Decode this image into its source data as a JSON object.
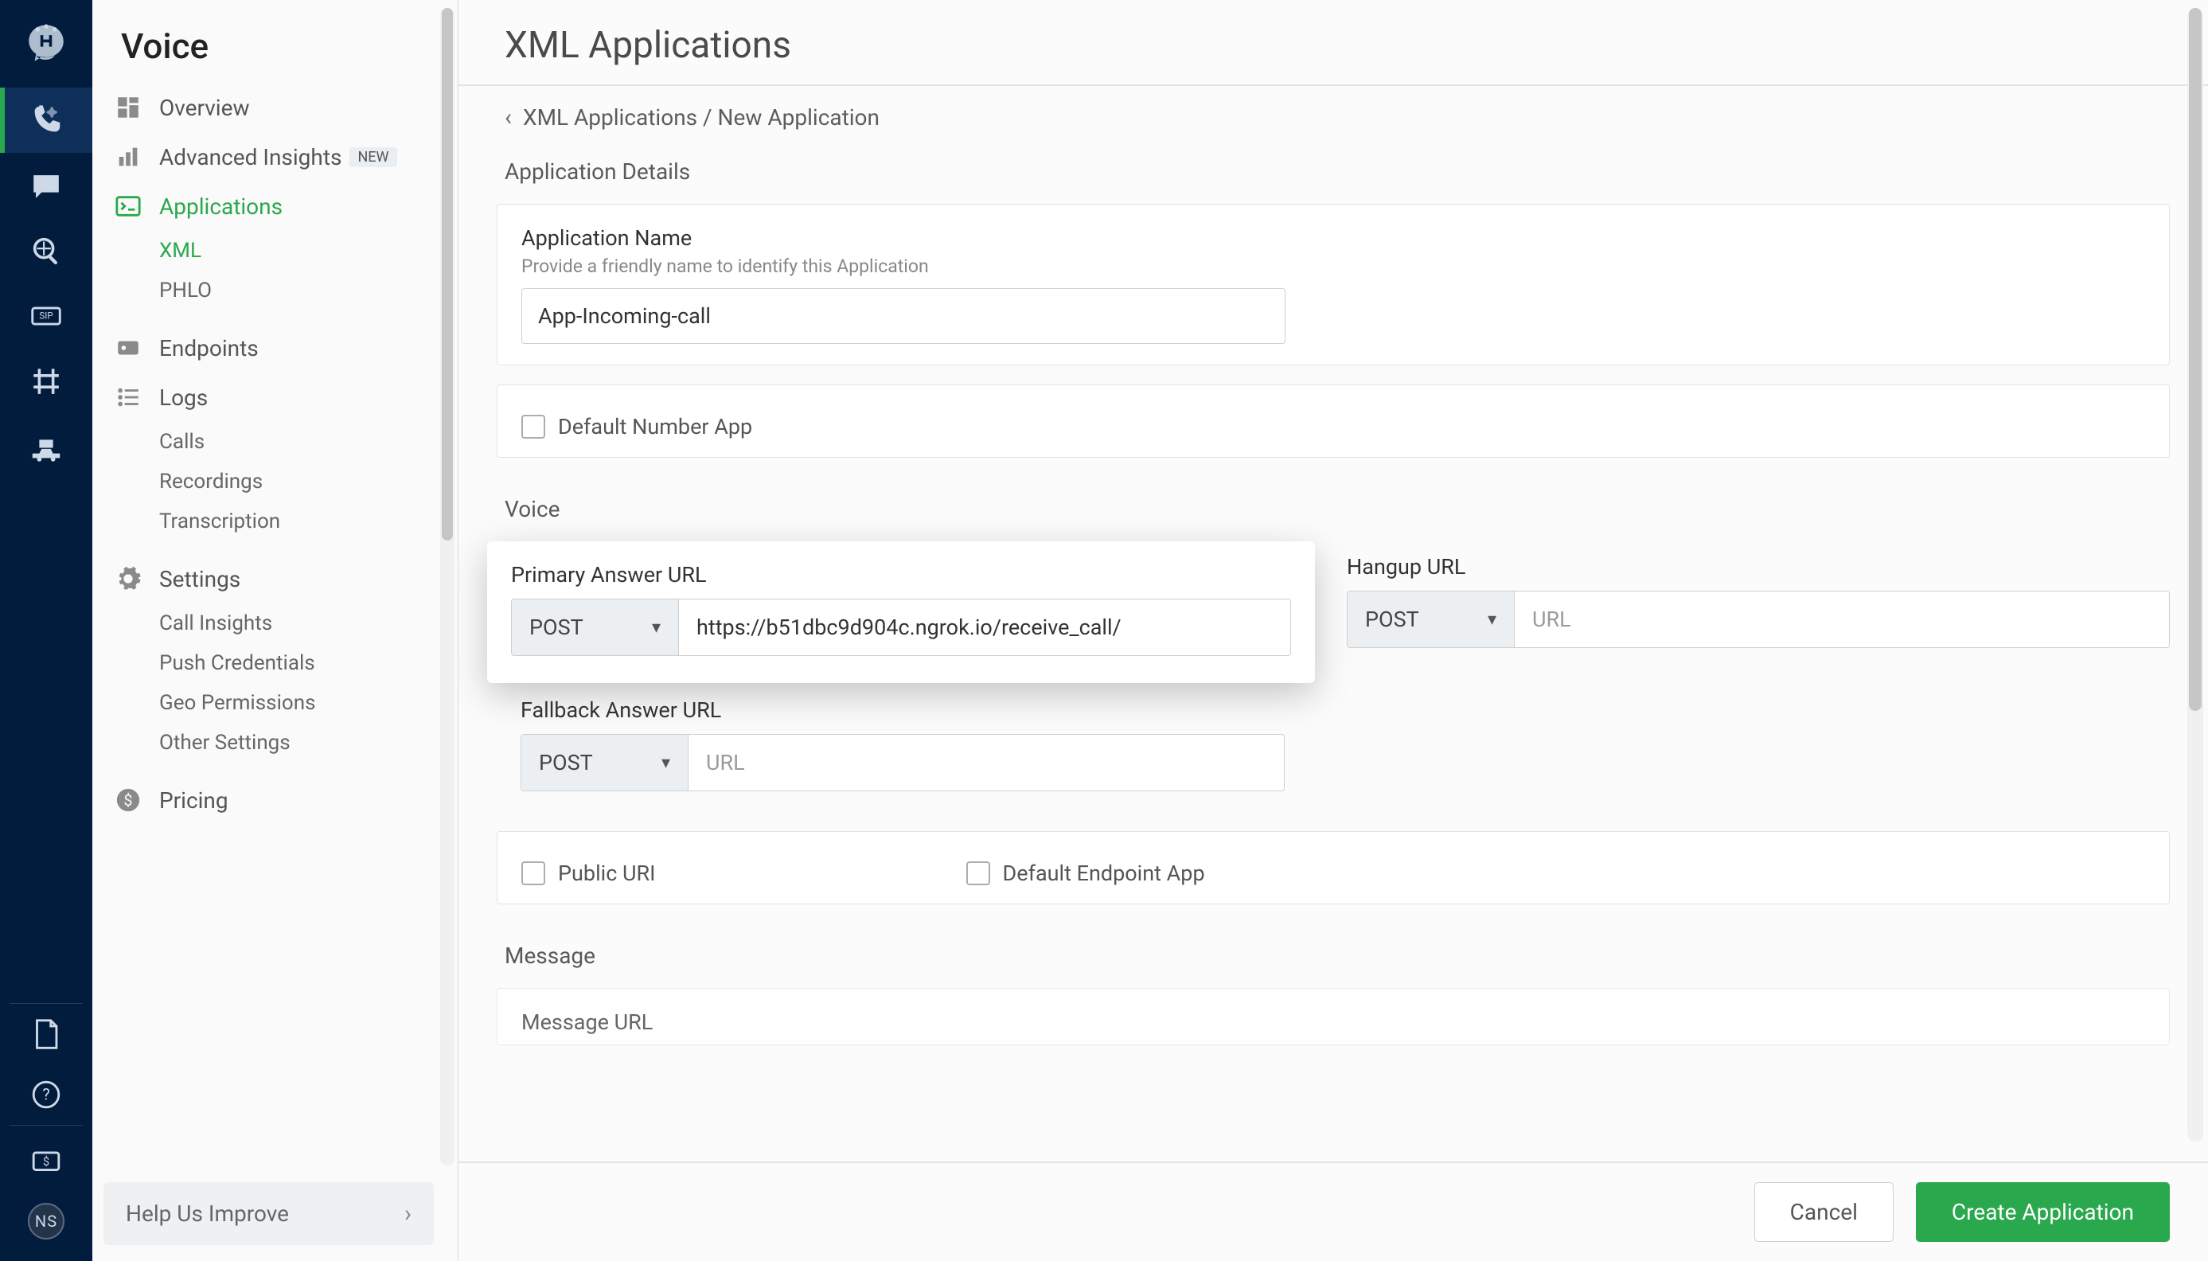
{
  "rail": {
    "avatar_initials": "NS"
  },
  "sidebar": {
    "title": "Voice",
    "sections": {
      "overview": "Overview",
      "advanced_insights": "Advanced Insights",
      "advanced_insights_badge": "NEW",
      "applications": "Applications",
      "xml": "XML",
      "phlo": "PHLO",
      "endpoints": "Endpoints",
      "logs": "Logs",
      "calls": "Calls",
      "recordings": "Recordings",
      "transcription": "Transcription",
      "settings": "Settings",
      "call_insights": "Call Insights",
      "push_credentials": "Push Credentials",
      "geo_permissions": "Geo Permissions",
      "other_settings": "Other Settings",
      "pricing": "Pricing"
    },
    "footer": "Help Us Improve"
  },
  "main": {
    "page_title": "XML Applications",
    "breadcrumb": "XML Applications / New Application",
    "sections": {
      "app_details": "Application Details",
      "voice": "Voice",
      "message": "Message"
    },
    "app_name": {
      "label": "Application Name",
      "hint": "Provide a friendly name to identify this Application",
      "value": "App-Incoming-call"
    },
    "default_number_app": "Default Number App",
    "primary_answer": {
      "label": "Primary Answer URL",
      "method": "POST",
      "value": "https://b51dbc9d904c.ngrok.io/receive_call/",
      "placeholder": "URL"
    },
    "hangup": {
      "label": "Hangup URL",
      "method": "POST",
      "value": "",
      "placeholder": "URL"
    },
    "fallback": {
      "label": "Fallback Answer URL",
      "method": "POST",
      "value": "",
      "placeholder": "URL"
    },
    "public_uri": "Public URI",
    "default_endpoint_app": "Default Endpoint App",
    "message_url_label": "Message URL",
    "actions": {
      "cancel": "Cancel",
      "create": "Create Application"
    }
  }
}
